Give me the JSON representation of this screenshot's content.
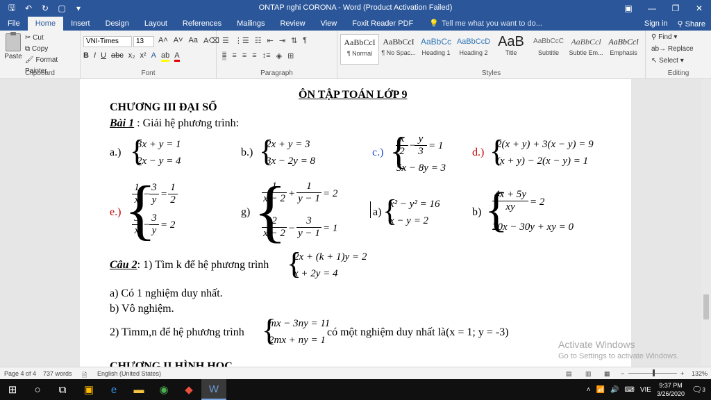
{
  "window": {
    "title": "ONTAP  nghi CORONA - Word (Product Activation Failed)",
    "controls": [
      "▣",
      "—",
      "❐",
      "✕"
    ]
  },
  "qat": [
    "save-icon",
    "undo-icon",
    "redo-icon",
    "new-doc-icon",
    "customize-icon"
  ],
  "tabs": [
    "File",
    "Home",
    "Insert",
    "Design",
    "Layout",
    "References",
    "Mailings",
    "Review",
    "View",
    "Foxit Reader PDF"
  ],
  "active_tab": "Home",
  "tell_me": "Tell me what you want to do...",
  "sign_in": "Sign in",
  "share": "Share",
  "clipboard": {
    "paste": "Paste",
    "cut": "Cut",
    "copy": "Copy",
    "format_painter": "Format Painter",
    "label": "Clipboard"
  },
  "font": {
    "name": "VNI-Times",
    "size": "13",
    "label": "Font"
  },
  "paragraph": {
    "label": "Paragraph"
  },
  "styles": {
    "label": "Styles",
    "items": [
      {
        "sample": "AaBbCcI",
        "name": "¶ Normal"
      },
      {
        "sample": "AaBbCcI",
        "name": "¶ No Spac..."
      },
      {
        "sample": "AaBbCc",
        "name": "Heading 1"
      },
      {
        "sample": "AaBbCcD",
        "name": "Heading 2"
      },
      {
        "sample": "AaB",
        "name": "Title"
      },
      {
        "sample": "AaBbCcC",
        "name": "Subtitle"
      },
      {
        "sample": "AaBbCcl",
        "name": "Subtle Em..."
      },
      {
        "sample": "AaBbCcl",
        "name": "Emphasis"
      }
    ]
  },
  "editing": {
    "find": "Find",
    "replace": "Replace",
    "select": "Select",
    "label": "Editing"
  },
  "doc": {
    "heading": "ÔN TẬP TOÁN LỚP 9",
    "chapter": "CHƯƠNG III ĐẠI SỐ",
    "bai1_label": "Bài 1",
    "bai1_text": " : Giải hệ phương trình:",
    "labels": [
      "a.)",
      "b.)",
      "c.)",
      "d.)",
      "e.)",
      "g)",
      "a)",
      "b)"
    ],
    "sys_a": [
      "3x + y = 1",
      "2x − y = 4"
    ],
    "sys_b": [
      "2x + y = 3",
      "3x − 2y = 8"
    ],
    "sys_c2": "5x − 8y = 3",
    "sys_d": [
      "2(x + y) + 3(x − y) = 9",
      "(x + y) − 2(x − y) = 1"
    ],
    "sys_h": [
      "x² − y² = 16",
      "x − y = 2"
    ],
    "sys_b2_line2": "20x − 30y + xy = 0",
    "cau2_label": "Câu 2",
    "cau2_text": ": 1) Tìm k để hệ phương trình",
    "cau2_sys": [
      "2x + (k + 1)y = 2",
      "x + 2y = 4"
    ],
    "item_a": "a) Có 1 nghiệm duy nhất.",
    "item_b": "b) Vô nghiệm.",
    "q2_text": "2) Tìmm,n để hệ phương trình",
    "q2_sys": [
      "mx − 3ny = 11",
      "2mx + ny = 1"
    ],
    "q2_tail": "có một nghiệm duy nhất là(x = 1; y = -3)",
    "next_chapter": "CHƯƠNG II HÌNH HỌC"
  },
  "activate": {
    "line1": "Activate Windows",
    "line2": "Go to Settings to activate Windows."
  },
  "status": {
    "page": "Page 4 of 4",
    "words": "737 words",
    "language": "English (United States)",
    "zoom": "132%"
  },
  "taskbar": {
    "lang": "VIE",
    "time": "9:37 PM",
    "date": "3/26/2020",
    "notif": "3"
  }
}
